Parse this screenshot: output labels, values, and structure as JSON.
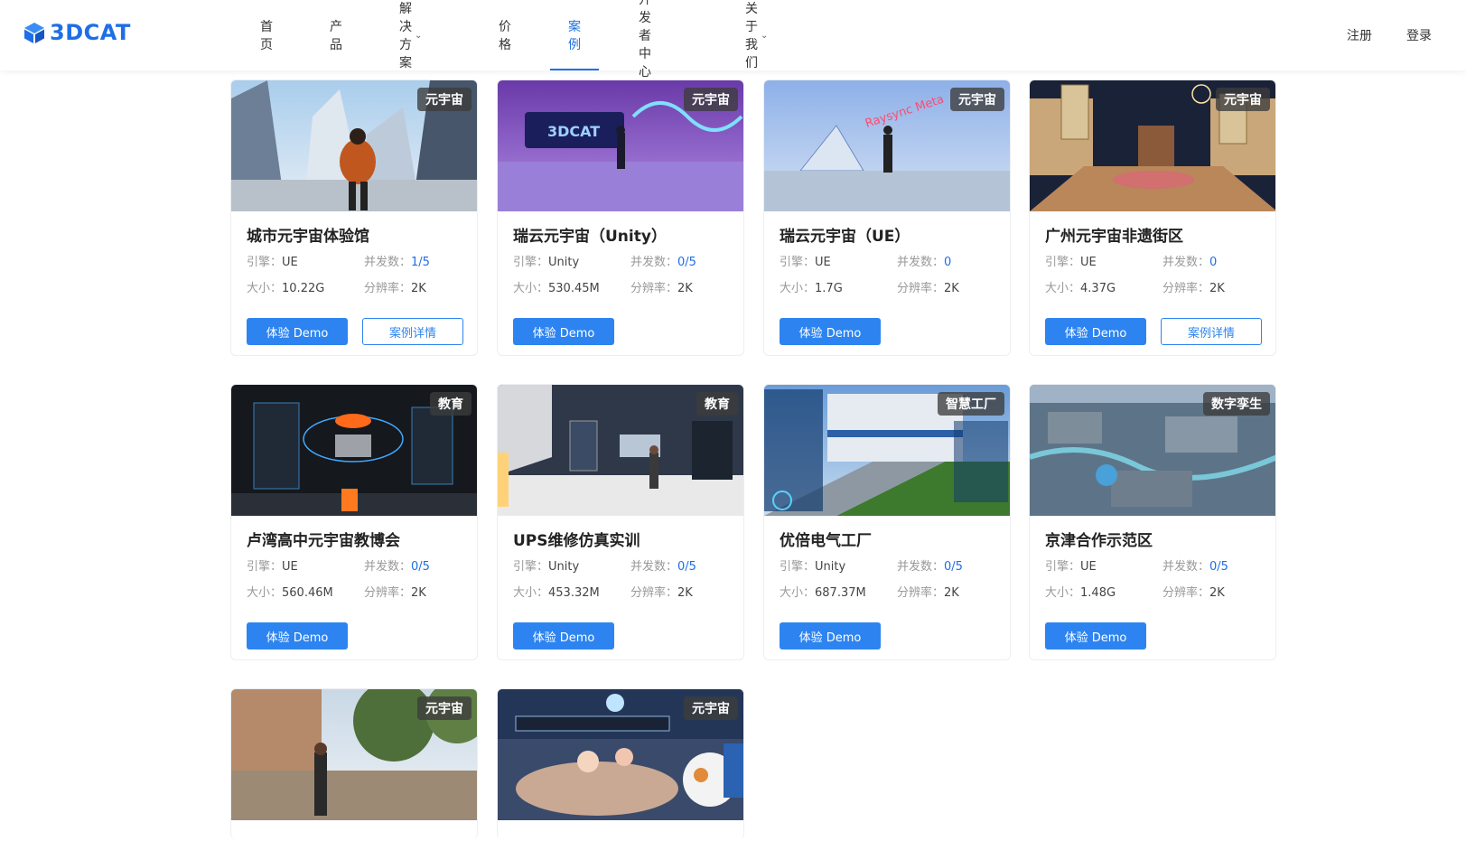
{
  "brand": {
    "name": "3DCAT",
    "color": "#1e6fe6"
  },
  "nav": [
    {
      "label": "首页",
      "dropdown": false,
      "active": false
    },
    {
      "label": "产品",
      "dropdown": false,
      "active": false
    },
    {
      "label": "解决方案",
      "dropdown": true,
      "active": false
    },
    {
      "label": "价格",
      "dropdown": false,
      "active": false
    },
    {
      "label": "案例",
      "dropdown": false,
      "active": true
    },
    {
      "label": "开发者中心",
      "dropdown": false,
      "active": false
    },
    {
      "label": "关于我们",
      "dropdown": true,
      "active": false
    }
  ],
  "auth": {
    "register": "注册",
    "login": "登录"
  },
  "labels": {
    "engine": "引擎：",
    "concurrency": "并发数：",
    "size": "大小：",
    "resolution": "分辨率：",
    "demo": "体验 Demo",
    "detail": "案例详情"
  },
  "cards": [
    {
      "tag": "元宇宙",
      "title": "城市元宇宙体验馆",
      "engine": "UE",
      "concurrency": "1/5",
      "size": "10.22G",
      "resolution": "2K",
      "has_detail": true,
      "scene": "city"
    },
    {
      "tag": "元宇宙",
      "title": "瑞云元宇宙（Unity）",
      "engine": "Unity",
      "concurrency": "0/5",
      "size": "530.45M",
      "resolution": "2K",
      "has_detail": false,
      "scene": "purple"
    },
    {
      "tag": "元宇宙",
      "title": "瑞云元宇宙（UE）",
      "engine": "UE",
      "concurrency": "0",
      "size": "1.7G",
      "resolution": "2K",
      "has_detail": false,
      "scene": "blue"
    },
    {
      "tag": "元宇宙",
      "title": "广州元宇宙非遗街区",
      "engine": "UE",
      "concurrency": "0",
      "size": "4.37G",
      "resolution": "2K",
      "has_detail": true,
      "scene": "street"
    },
    {
      "tag": "教育",
      "title": "卢湾高中元宇宙教博会",
      "engine": "UE",
      "concurrency": "0/5",
      "size": "560.46M",
      "resolution": "2K",
      "has_detail": false,
      "scene": "dark"
    },
    {
      "tag": "教育",
      "title": "UPS维修仿真实训",
      "engine": "Unity",
      "concurrency": "0/5",
      "size": "453.32M",
      "resolution": "2K",
      "has_detail": false,
      "scene": "office"
    },
    {
      "tag": "智慧工厂",
      "title": "优倍电气工厂",
      "engine": "Unity",
      "concurrency": "0/5",
      "size": "687.37M",
      "resolution": "2K",
      "has_detail": false,
      "scene": "factory"
    },
    {
      "tag": "数字孪生",
      "title": "京津合作示范区",
      "engine": "UE",
      "concurrency": "0/5",
      "size": "1.48G",
      "resolution": "2K",
      "has_detail": false,
      "scene": "aerial"
    },
    {
      "tag": "元宇宙",
      "title": "",
      "engine": "",
      "concurrency": "",
      "size": "",
      "resolution": "",
      "has_detail": false,
      "scene": "town",
      "partial": true
    },
    {
      "tag": "元宇宙",
      "title": "",
      "engine": "",
      "concurrency": "",
      "size": "",
      "resolution": "",
      "has_detail": false,
      "scene": "party",
      "partial": true
    }
  ]
}
